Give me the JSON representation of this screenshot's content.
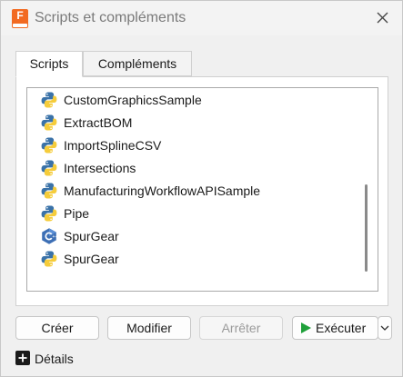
{
  "window": {
    "title": "Scripts et compléments",
    "app_icon_letter": "F",
    "accent": "#f26a21"
  },
  "tabs": [
    {
      "label": "Scripts",
      "active": true
    },
    {
      "label": "Compléments",
      "active": false
    }
  ],
  "scripts": [
    {
      "label": "CustomGraphicsSample",
      "icon": "python-icon"
    },
    {
      "label": "ExtractBOM",
      "icon": "python-icon"
    },
    {
      "label": "ImportSplineCSV",
      "icon": "python-icon"
    },
    {
      "label": "Intersections",
      "icon": "python-icon"
    },
    {
      "label": "ManufacturingWorkflowAPISample",
      "icon": "python-icon"
    },
    {
      "label": "Pipe",
      "icon": "python-icon"
    },
    {
      "label": "SpurGear",
      "icon": "cpp-icon"
    },
    {
      "label": "SpurGear",
      "icon": "python-icon"
    }
  ],
  "buttons": {
    "create": "Créer",
    "edit": "Modifier",
    "stop": "Arrêter",
    "run": "Exécuter"
  },
  "details_label": "Détails",
  "colors": {
    "play": "#1fa03a",
    "python_blue": "#3a72a8",
    "python_yellow": "#f5cc3b",
    "cpp_blue": "#3d6fb5"
  }
}
